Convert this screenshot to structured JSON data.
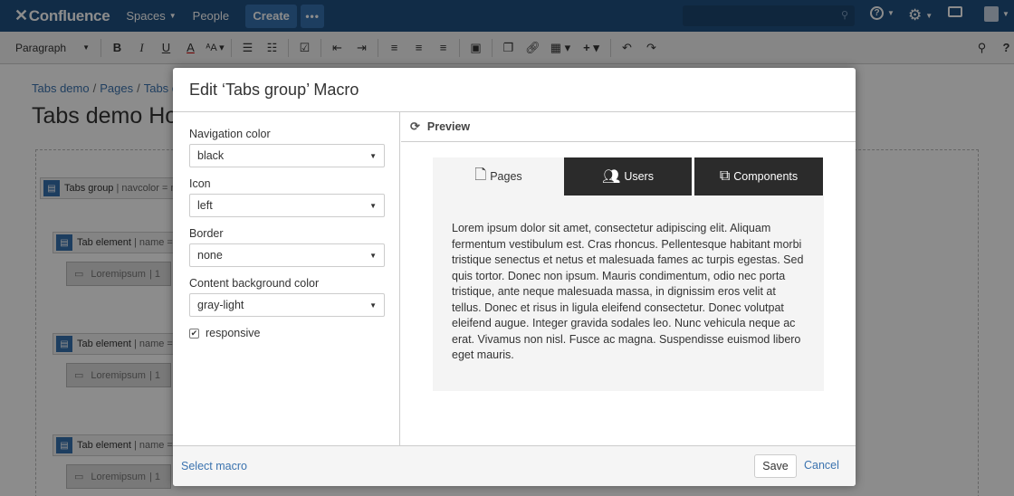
{
  "topnav": {
    "logo": "Confluence",
    "spaces": "Spaces",
    "people": "People",
    "create": "Create",
    "more": "•••"
  },
  "toolbar": {
    "paragraph": "Paragraph"
  },
  "page": {
    "breadcrumb": [
      "Tabs demo",
      "Pages",
      "Tabs c"
    ],
    "title": "Tabs demo Ho",
    "macros": {
      "tabs_group": "Tabs group",
      "tabs_group_params": "| navcolor = n",
      "tab_element": "Tab element",
      "tab_element_params": "| name =",
      "lorem": "Loremipsum",
      "lorem_params": "| 1"
    }
  },
  "dialog": {
    "title": "Edit ‘Tabs group’ Macro",
    "fields": [
      {
        "label": "Navigation color",
        "value": "black"
      },
      {
        "label": "Icon",
        "value": "left"
      },
      {
        "label": "Border",
        "value": "none"
      },
      {
        "label": "Content background color",
        "value": "gray-light"
      }
    ],
    "responsive_label": "responsive",
    "responsive_checked": true,
    "preview_label": "Preview",
    "tabs": [
      {
        "label": "Pages",
        "icon": "pages-icon",
        "active": true
      },
      {
        "label": "Users",
        "icon": "users-icon",
        "active": false
      },
      {
        "label": "Components",
        "icon": "components-icon",
        "active": false
      }
    ],
    "content": "Lorem ipsum dolor sit amet, consectetur adipiscing elit. Aliquam fermentum vestibulum est. Cras rhoncus. Pellentesque habitant morbi tristique senectus et netus et malesuada fames ac turpis egestas. Sed quis tortor. Donec non ipsum. Mauris condimentum, odio nec porta tristique, ante neque malesuada massa, in dignissim eros velit at tellus. Donec et risus in ligula eleifend consectetur. Donec volutpat eleifend augue. Integer gravida sodales leo. Nunc vehicula neque ac erat. Vivamus non nisl. Fusce ac magna. Suspendisse euismod libero eget mauris.",
    "footer": {
      "select_macro": "Select macro",
      "save": "Save",
      "cancel": "Cancel"
    }
  },
  "colors": {
    "nav": "#205081",
    "nav_button": "#3572b0",
    "link": "#3b73af",
    "dark_tab": "#2b2b2b",
    "tab_bg": "#f4f4f4"
  }
}
